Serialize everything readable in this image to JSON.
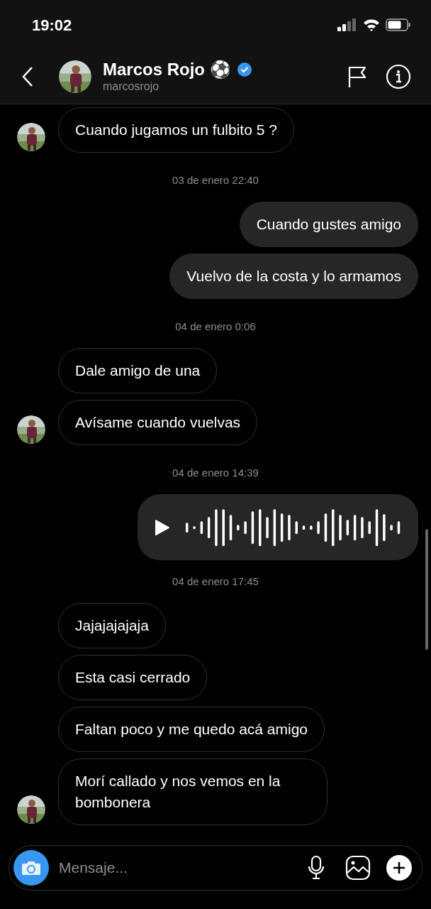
{
  "status_bar": {
    "time": "19:02"
  },
  "header": {
    "name": "Marcos Rojo ⚽",
    "verified": true,
    "username": "marcosrojo"
  },
  "messages": [
    {
      "kind": "incoming",
      "text": "Cuando jugamos un fulbito 5 ?",
      "avatar": true
    },
    {
      "kind": "time",
      "text": "03 de enero 22:40"
    },
    {
      "kind": "outgoing",
      "text": "Cuando gustes amigo"
    },
    {
      "kind": "outgoing",
      "text": "Vuelvo de la costa y lo armamos"
    },
    {
      "kind": "time",
      "text": "04 de enero 0:06"
    },
    {
      "kind": "incoming",
      "text": "Dale amigo de una",
      "avatar": false
    },
    {
      "kind": "incoming",
      "text": "Avísame cuando vuelvas",
      "avatar": true
    },
    {
      "kind": "time",
      "text": "04 de enero 14:39"
    },
    {
      "kind": "voice"
    },
    {
      "kind": "time",
      "text": "04 de enero 17:45"
    },
    {
      "kind": "incoming",
      "text": "Jajajajajaja",
      "avatar": false
    },
    {
      "kind": "incoming",
      "text": "Esta casi cerrado",
      "avatar": false
    },
    {
      "kind": "incoming",
      "text": "Faltan poco y me quedo acá amigo",
      "avatar": false
    },
    {
      "kind": "incoming",
      "text": "Morí callado y nos vemos en la bombonera",
      "avatar": true
    }
  ],
  "composer": {
    "placeholder": "Mensaje..."
  }
}
